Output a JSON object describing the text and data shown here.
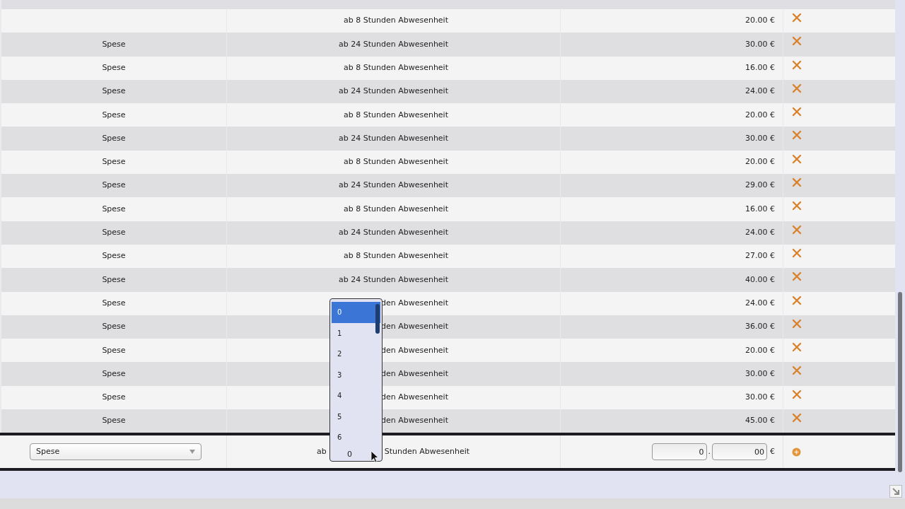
{
  "rows": [
    {
      "condition": "ab 8 Stunden Abwesenheit",
      "amount": "20.00 €"
    },
    {
      "type": "Spese",
      "condition": "ab 24 Stunden Abwesenheit",
      "amount": "30.00 €"
    },
    {
      "type": "Spese",
      "condition": "ab 8 Stunden Abwesenheit",
      "amount": "16.00 €"
    },
    {
      "type": "Spese",
      "condition": "ab 24 Stunden Abwesenheit",
      "amount": "24.00 €"
    },
    {
      "type": "Spese",
      "condition": "ab 8 Stunden Abwesenheit",
      "amount": "20.00 €"
    },
    {
      "type": "Spese",
      "condition": "ab 24 Stunden Abwesenheit",
      "amount": "30.00 €"
    },
    {
      "type": "Spese",
      "condition": "ab 8 Stunden Abwesenheit",
      "amount": "20.00 €"
    },
    {
      "type": "Spese",
      "condition": "ab 24 Stunden Abwesenheit",
      "amount": "29.00 €"
    },
    {
      "type": "Spese",
      "condition": "ab 8 Stunden Abwesenheit",
      "amount": "16.00 €"
    },
    {
      "type": "Spese",
      "condition": "ab 24 Stunden Abwesenheit",
      "amount": "24.00 €"
    },
    {
      "type": "Spese",
      "condition": "ab 8 Stunden Abwesenheit",
      "amount": "27.00 €"
    },
    {
      "type": "Spese",
      "condition": "ab 24 Stunden Abwesenheit",
      "amount": "40.00 €"
    },
    {
      "type": "Spese",
      "condition": "den Abwesenheit",
      "amount": "24.00 €"
    },
    {
      "type": "Spese",
      "condition": "den Abwesenheit",
      "amount": "36.00 €"
    },
    {
      "type": "Spese",
      "condition": "den Abwesenheit",
      "amount": "20.00 €"
    },
    {
      "type": "Spese",
      "condition": "den Abwesenheit",
      "amount": "30.00 €"
    },
    {
      "type": "Spese",
      "condition": "den Abwesenheit",
      "amount": "30.00 €"
    },
    {
      "type": "Spese",
      "condition": "den Abwesenheit",
      "amount": "45.00 €"
    }
  ],
  "entry": {
    "type_select": "Spese",
    "prefix": "ab",
    "hours_select": {
      "value": "0",
      "open": true,
      "options": [
        {
          "label": "0",
          "selected": true
        },
        {
          "label": "1",
          "selected": false
        },
        {
          "label": "2",
          "selected": false
        },
        {
          "label": "3",
          "selected": false
        },
        {
          "label": "4",
          "selected": false
        },
        {
          "label": "5",
          "selected": false
        },
        {
          "label": "6",
          "selected": false
        }
      ]
    },
    "suffix": "Stunden Abwesenheit",
    "amount_whole": "0",
    "decimal_separator": ".",
    "amount_cents": "00",
    "currency": "€"
  }
}
